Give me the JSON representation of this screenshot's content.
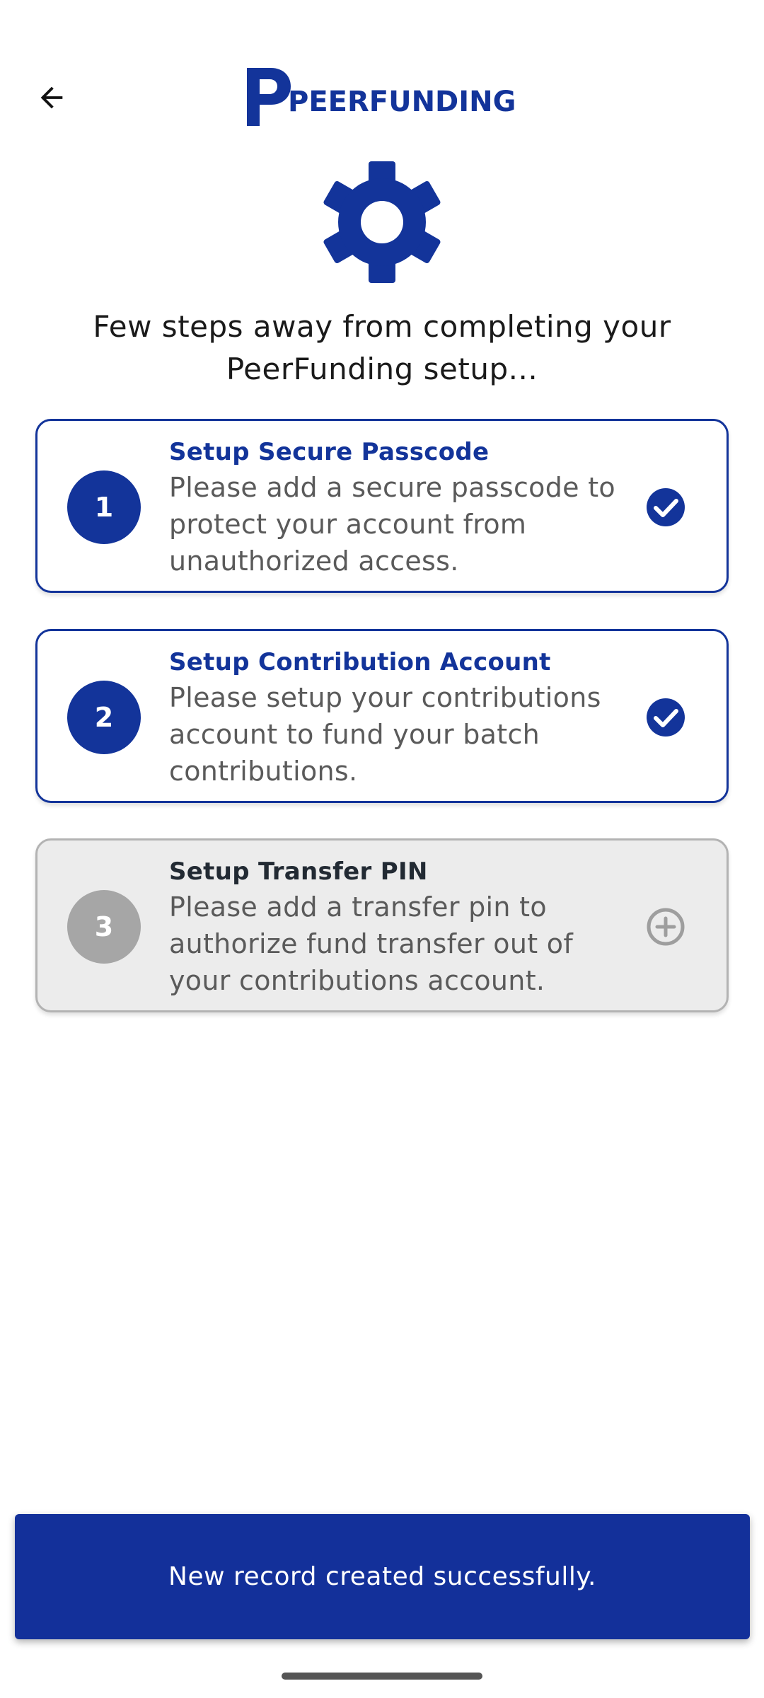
{
  "header": {
    "back_icon": "arrow-left-icon",
    "logo_text": "PEERFUNDING",
    "brand_color": "#13349a"
  },
  "hero": {
    "icon": "gear-icon",
    "intro_text": "Few steps away from completing your PeerFunding setup..."
  },
  "steps": [
    {
      "number": "1",
      "title": "Setup Secure Passcode",
      "description": "Please add a secure passcode to protect your account from unauthorized access.",
      "status": "completed",
      "status_icon": "check-circle-icon"
    },
    {
      "number": "2",
      "title": "Setup Contribution Account",
      "description": "Please setup your contributions account to fund your batch contributions.",
      "status": "completed",
      "status_icon": "check-circle-icon"
    },
    {
      "number": "3",
      "title": "Setup Transfer PIN",
      "description": "Please add a transfer pin to authorize fund transfer out of your contributions account.",
      "status": "pending",
      "status_icon": "plus-circle-icon"
    }
  ],
  "snackbar": {
    "message": "New record created successfully.",
    "background_color": "#13309a"
  },
  "colors": {
    "primary": "#13349a",
    "disabled_bg": "#ececec",
    "disabled_circle": "#a6a6a6"
  }
}
